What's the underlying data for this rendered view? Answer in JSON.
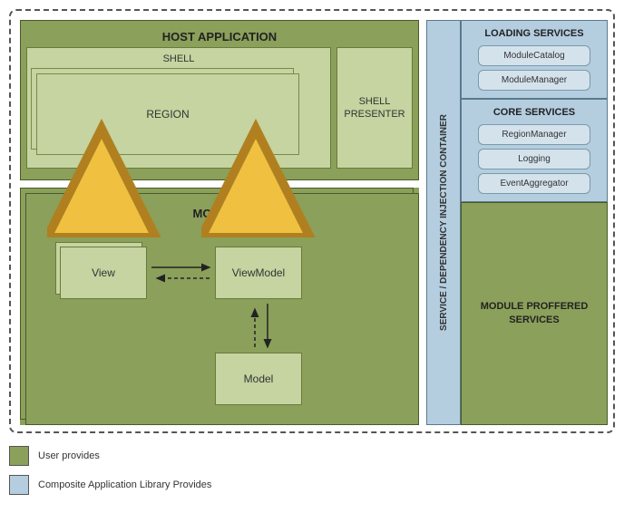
{
  "host": {
    "title": "HOST APPLICATION",
    "shell": "SHELL",
    "region": "REGION",
    "presenter": "SHELL PRESENTER"
  },
  "modules": {
    "title": "MODULES",
    "view": "View",
    "viewmodel": "ViewModel",
    "model": "Model"
  },
  "container": "SERVICE / DEPENDENCY INJECTION CONTAINER",
  "loading": {
    "title": "LOADING SERVICES",
    "catalog": "ModuleCatalog",
    "manager": "ModuleManager"
  },
  "core": {
    "title": "CORE SERVICES",
    "region": "RegionManager",
    "logging": "Logging",
    "event": "EventAggregator"
  },
  "proffered": "MODULE PROFFERED SERVICES",
  "legend": {
    "user": "User provides",
    "lib": "Composite Application Library Provides"
  }
}
